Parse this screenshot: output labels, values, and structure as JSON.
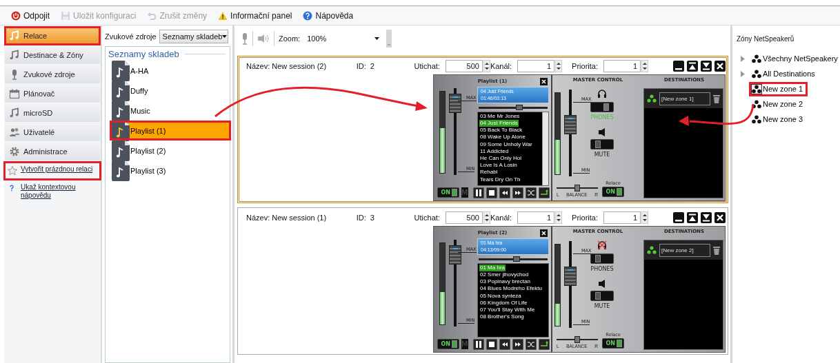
{
  "toolbar": [
    {
      "label": "Odpojit",
      "kind": "power",
      "disabled": false
    },
    {
      "label": "Uložit konfiguraci",
      "kind": "save",
      "disabled": true
    },
    {
      "label": "Zrušit změny",
      "kind": "undo",
      "disabled": true
    },
    {
      "label": "Informační panel",
      "kind": "warning",
      "disabled": false
    },
    {
      "label": "Nápověda",
      "kind": "help",
      "disabled": false
    }
  ],
  "nav": {
    "items": [
      {
        "label": "Relace",
        "kind": "music",
        "selected": true,
        "highlighted": true
      },
      {
        "label": "Destinace & Zóny",
        "kind": "music",
        "selected": false,
        "highlighted": false
      },
      {
        "label": "Zvukové zdroje",
        "kind": "mic",
        "selected": false,
        "highlighted": false
      },
      {
        "label": "Plánovač",
        "kind": "calendar",
        "selected": false,
        "highlighted": false
      },
      {
        "label": "microSD",
        "kind": "music",
        "selected": false,
        "highlighted": false
      },
      {
        "label": "Uživatelé",
        "kind": "users",
        "selected": false,
        "highlighted": false
      },
      {
        "label": "Administrace",
        "kind": "gear",
        "selected": false,
        "highlighted": false
      }
    ],
    "links": [
      {
        "label": "Vytvořit prázdnou relaci",
        "kind": "star",
        "highlighted": true
      },
      {
        "label": "Ukaž kontextovou nápovědu",
        "kind": "question",
        "highlighted": false
      }
    ]
  },
  "sources": {
    "label": "Zvukové zdroje",
    "value": "Seznamy skladeb",
    "heading": "Seznamy skladeb",
    "items": [
      {
        "label": "A-HA",
        "selected": false,
        "highlighted": false
      },
      {
        "label": "Duffy",
        "selected": false,
        "highlighted": false
      },
      {
        "label": "Music",
        "selected": false,
        "highlighted": false
      },
      {
        "label": "Playlist (1)",
        "selected": true,
        "highlighted": true
      },
      {
        "label": "Playlist (2)",
        "selected": false,
        "highlighted": false
      },
      {
        "label": "Playlist (3)",
        "selected": false,
        "highlighted": false
      }
    ]
  },
  "view": {
    "zoom_label": "Zoom:",
    "zoom_value": "100%"
  },
  "sessions": [
    {
      "name_label": "Název:",
      "name": "New session (2)",
      "id_label": "ID:",
      "id": "2",
      "active": true,
      "fields": [
        {
          "label": "Utichat:",
          "value": "500"
        },
        {
          "label": "Kanál:",
          "value": "1"
        },
        {
          "label": "Priorita:",
          "value": "1"
        }
      ],
      "player": {
        "title": "Playlist (1)",
        "now_playing": "04 Just Friends",
        "time": "01:46/03:13",
        "max_label": "MAX",
        "min_label": "MIN",
        "vu": {
          "level": 0.55
        },
        "volume": {
          "level": 0.92
        },
        "seek": {
          "level": 0.6
        },
        "on_label": "ON",
        "on": true,
        "mute_label": "M",
        "tracks": [
          {
            "title": "03 Me  Mr Jones",
            "selected": false
          },
          {
            "title": "04 Just Friends",
            "selected": true
          },
          {
            "title": "05 Back To Black",
            "selected": false
          },
          {
            "title": "08 Wake Up Alone",
            "selected": false
          },
          {
            "title": "09 Some Unholy War",
            "selected": false
          },
          {
            "title": "11 Addicted",
            "selected": false
          },
          {
            "title": "He Can Only Hol",
            "selected": false
          },
          {
            "title": "Love Is A Losin",
            "selected": false
          },
          {
            "title": "Rehabl",
            "selected": false
          },
          {
            "title": "Tears Dry On Th",
            "selected": false
          }
        ]
      },
      "master": {
        "title": "MASTER CONTROL",
        "max_label": "MAX",
        "min_label": "MIN",
        "vu": {
          "level": 0.42
        },
        "volume": {
          "level": 0.62
        },
        "phones": {
          "label": "PHONES",
          "on": true
        },
        "mute": {
          "label": "MUTE",
          "on": false
        },
        "balance": {
          "level": 0.5,
          "left": "L",
          "center": "BALANCE",
          "right": "R"
        },
        "relace_label": "Relace",
        "on_label": "ON",
        "on": true
      },
      "destinations": {
        "title": "DESTINATIONS",
        "zones": [
          "[New zone 1]"
        ]
      }
    },
    {
      "name_label": "Název:",
      "name": "New session (1)",
      "id_label": "ID:",
      "id": "3",
      "active": false,
      "fields": [
        {
          "label": "Utichat:",
          "value": "500"
        },
        {
          "label": "Kanál:",
          "value": "1"
        },
        {
          "label": "Priorita:",
          "value": "1"
        }
      ],
      "player": {
        "title": "Playlist (2)",
        "now_playing": "01 Ma hra",
        "time": "04:13/09:00",
        "max_label": "MAX",
        "min_label": "MIN",
        "vu": {
          "level": 0.4
        },
        "volume": {
          "level": 0.92
        },
        "seek": {
          "level": 0.55
        },
        "on_label": "ON",
        "on": true,
        "mute_label": "M",
        "tracks": [
          {
            "title": "01 Ma hra",
            "selected": true
          },
          {
            "title": "02 Smer jihovychod",
            "selected": false
          },
          {
            "title": "03 Popinavy brectan",
            "selected": false
          },
          {
            "title": "04 Blues Modreho Efektu",
            "selected": false
          },
          {
            "title": "05 Nova synteza",
            "selected": false
          },
          {
            "title": "06 Kingdom Of Life",
            "selected": false
          },
          {
            "title": "07 You'll Stay With Me",
            "selected": false
          },
          {
            "title": "08 Brother's Song",
            "selected": false
          }
        ]
      },
      "master": {
        "title": "MASTER CONTROL",
        "max_label": "MAX",
        "min_label": "MIN",
        "vu": {
          "level": 0.27
        },
        "volume": {
          "level": 0.62
        },
        "phones": {
          "label": "PHONES",
          "on": false
        },
        "mute": {
          "label": "MUTE",
          "on": false
        },
        "balance": {
          "level": 0.5,
          "left": "L",
          "center": "BALANCE",
          "right": "R"
        },
        "relace_label": "Relace",
        "on_label": "ON",
        "on": true
      },
      "destinations": {
        "title": "DESTINATIONS",
        "zones": [
          "[New zone 2]"
        ]
      }
    }
  ],
  "zones": {
    "title": "Zóny NetSpeakerů",
    "items": [
      {
        "label": "Všechny NetSpeakery",
        "expandable": true,
        "selected": false,
        "highlighted": false
      },
      {
        "label": "All Destinations",
        "expandable": true,
        "selected": false,
        "highlighted": false
      },
      {
        "label": "New zone 1",
        "expandable": false,
        "selected": true,
        "highlighted": true
      },
      {
        "label": "New zone 2",
        "expandable": false,
        "selected": false,
        "highlighted": false
      },
      {
        "label": "New zone 3",
        "expandable": false,
        "selected": false,
        "highlighted": false
      }
    ]
  }
}
